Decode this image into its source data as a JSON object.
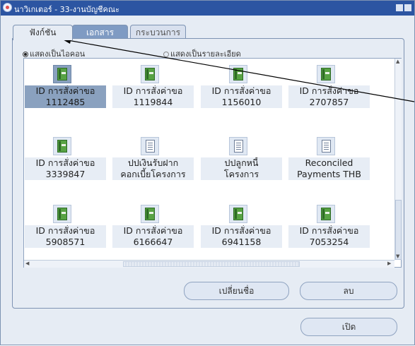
{
  "window": {
    "title": "นาวิเกเตอร์ - 33-งานบัญชีคณะ"
  },
  "tabs": [
    {
      "label": "ฟังก์ชัน"
    },
    {
      "label": "เอกสาร"
    },
    {
      "label": "กระบวนการ"
    }
  ],
  "view_options": {
    "icons": "แสดงเป็นไอคอน",
    "details": "แสดงเป็นรายละเอียด"
  },
  "items": [
    {
      "label": "ID การสั่งค่าขอ\n1112485",
      "icon": "book-icon"
    },
    {
      "label": "ID การสั่งค่าขอ\n1119844",
      "icon": "book-icon"
    },
    {
      "label": "ID การสั่งค่าขอ\n1156010",
      "icon": "book-icon"
    },
    {
      "label": "ID การสั่งค่าขอ\n2707857",
      "icon": "book-icon"
    },
    {
      "label": "ID การสั่งค่าขอ\n3339847",
      "icon": "book-icon"
    },
    {
      "label": "ปปเงินรับฝาก\nคอกเบี้ยโครงการ\nบริจาค",
      "icon": "document-icon"
    },
    {
      "label": "ปปลูกหนี้\nโครงการ",
      "icon": "document-icon"
    },
    {
      "label": "Reconciled\nPayments THB",
      "icon": "document-icon"
    },
    {
      "label": "ID การสั่งค่าขอ\n5908571",
      "icon": "book-icon"
    },
    {
      "label": "ID การสั่งค่าขอ\n6166647",
      "icon": "book-icon"
    },
    {
      "label": "ID การสั่งค่าขอ\n6941158",
      "icon": "book-icon"
    },
    {
      "label": "ID การสั่งค่าขอ\n7053254",
      "icon": "book-icon"
    }
  ],
  "buttons": {
    "rename": "เปลี่ยนชื่อ",
    "delete": "ลบ",
    "open": "เปิด"
  },
  "colors": {
    "titlebar": "#2c55a2",
    "active_tab": "#7f9bc3",
    "selection": "#8aa1bf"
  }
}
